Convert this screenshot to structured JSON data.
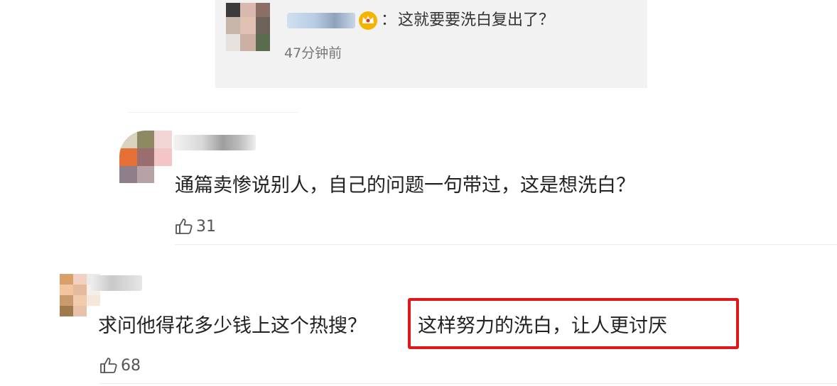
{
  "reply": {
    "text": "这就要要洗白复出了？",
    "colon": "：",
    "time": "47分钟前"
  },
  "comments": [
    {
      "text": "通篇卖惨说别人，自己的问题一句带过，这是想洗白？",
      "likes": "31"
    },
    {
      "text_before": "求问他得花多少钱上这个热搜？",
      "text_highlighted": "这样努力的洗白，让人更讨厌",
      "likes": "68"
    }
  ],
  "icons": {
    "like": "thumbs-up-icon",
    "vip": "crown-icon"
  },
  "colors": {
    "highlight_border": "#e01818",
    "reply_bg": "#f2f2f2"
  }
}
